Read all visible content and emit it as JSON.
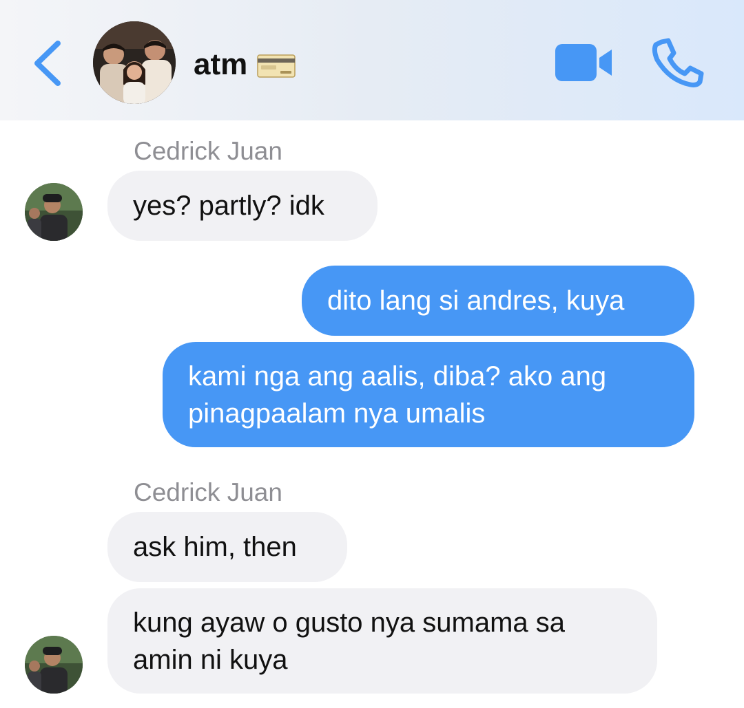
{
  "header": {
    "title": "atm",
    "back_icon": "chevron-left-icon",
    "card_emoji": "credit-card-icon",
    "video_icon": "video-camera-icon",
    "call_icon": "phone-icon",
    "accent": "#4797f5"
  },
  "messages": [
    {
      "sender": "Cedrick Juan",
      "direction": "in",
      "text": "yes? partly? idk"
    },
    {
      "direction": "out",
      "text": "dito lang si andres, kuya"
    },
    {
      "direction": "out",
      "text": "kami nga ang aalis, diba? ako ang pinagpaalam nya umalis"
    },
    {
      "sender": "Cedrick Juan",
      "direction": "in",
      "text": "ask him, then"
    },
    {
      "direction": "in",
      "text": "kung ayaw o gusto nya sumama sa amin ni kuya"
    }
  ],
  "colors": {
    "incoming_bubble": "#f1f1f4",
    "outgoing_bubble": "#4797f5",
    "sender_label": "#8e8e93"
  }
}
